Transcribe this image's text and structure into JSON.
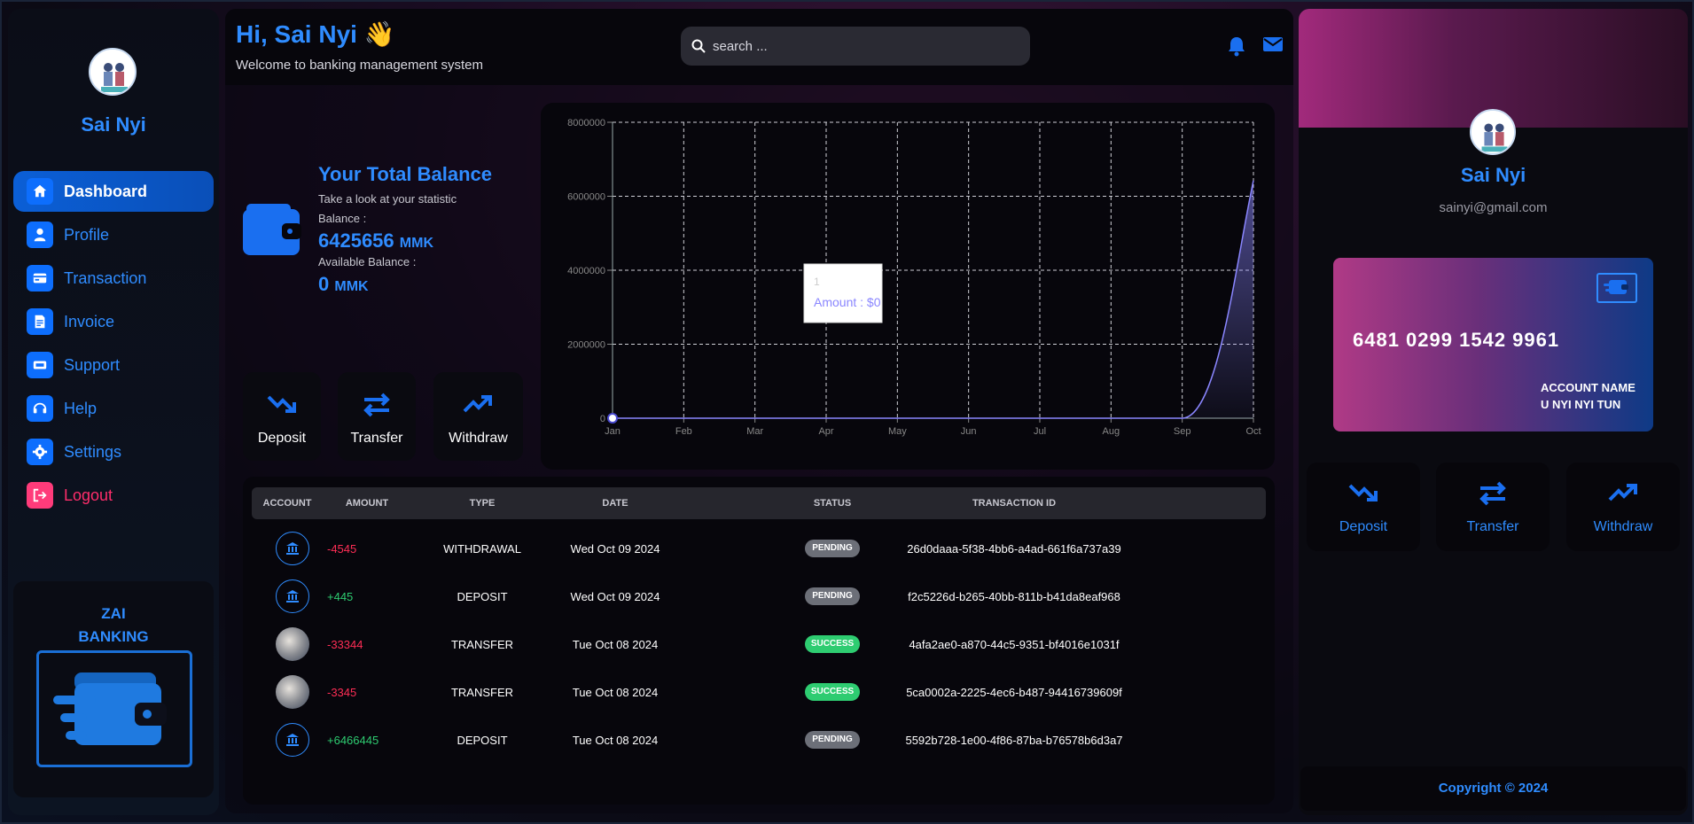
{
  "sidebar": {
    "user_name": "Sai Nyi",
    "items": [
      {
        "label": "Dashboard",
        "icon": "home-icon"
      },
      {
        "label": "Profile",
        "icon": "user-icon"
      },
      {
        "label": "Transaction",
        "icon": "card-icon"
      },
      {
        "label": "Invoice",
        "icon": "invoice-icon"
      },
      {
        "label": "Support",
        "icon": "support-icon"
      },
      {
        "label": "Help",
        "icon": "headset-icon"
      },
      {
        "label": "Settings",
        "icon": "gear-icon"
      },
      {
        "label": "Logout",
        "icon": "logout-icon"
      }
    ],
    "promo_line1": "ZAI",
    "promo_line2": "BANKING"
  },
  "header": {
    "greeting": "Hi, Sai Nyi 👋",
    "subtitle": "Welcome to banking management system",
    "search_placeholder": "search ..."
  },
  "balance": {
    "title": "Your Total Balance",
    "subtitle": "Take a look at your statistic",
    "balance_label": "Balance :",
    "balance_value": "6425656",
    "unit": "MMK",
    "available_label": "Available Balance :",
    "available_value": "0"
  },
  "actions": {
    "deposit": "Deposit",
    "transfer": "Transfer",
    "withdraw": "Withdraw"
  },
  "chart_data": {
    "type": "area",
    "categories": [
      "Jan",
      "Feb",
      "Mar",
      "Apr",
      "May",
      "Jun",
      "Jul",
      "Aug",
      "Sep",
      "Oct"
    ],
    "values": [
      0,
      0,
      0,
      0,
      0,
      0,
      0,
      0,
      0,
      6425656
    ],
    "yticks": [
      "0",
      "2000000",
      "4000000",
      "6000000",
      "8000000"
    ],
    "ylim": [
      0,
      8000000
    ],
    "grid": true,
    "tooltip_title": "1",
    "tooltip_value": "Amount : $0",
    "accent": "#8a86ff"
  },
  "table": {
    "headers": [
      "ACCOUNT",
      "AMOUNT",
      "TYPE",
      "DATE",
      "STATUS",
      "TRANSACTION ID"
    ],
    "rows": [
      {
        "account": "bank",
        "amount": "-4545",
        "type": "WITHDRAWAL",
        "date": "Wed Oct 09 2024",
        "status": "PENDING",
        "id": "26d0daaa-5f38-4bb6-a4ad-661f6a737a39"
      },
      {
        "account": "bank",
        "amount": "+445",
        "type": "DEPOSIT",
        "date": "Wed Oct 09 2024",
        "status": "PENDING",
        "id": "f2c5226d-b265-40bb-811b-b41da8eaf968"
      },
      {
        "account": "photo",
        "amount": "-33344",
        "type": "TRANSFER",
        "date": "Tue Oct 08 2024",
        "status": "SUCCESS",
        "id": "4afa2ae0-a870-44c5-9351-bf4016e1031f"
      },
      {
        "account": "photo",
        "amount": "-3345",
        "type": "TRANSFER",
        "date": "Tue Oct 08 2024",
        "status": "SUCCESS",
        "id": "5ca0002a-2225-4ec6-b487-94416739609f"
      },
      {
        "account": "bank",
        "amount": "+6466445",
        "type": "DEPOSIT",
        "date": "Tue Oct 08 2024",
        "status": "PENDING",
        "id": "5592b728-1e00-4f86-87ba-b76578b6d3a7"
      }
    ]
  },
  "right_panel": {
    "name": "Sai Nyi",
    "email": "sainyi@gmail.com",
    "card_number": "6481 0299 1542 9961",
    "account_name_label": "ACCOUNT NAME",
    "account_name": "U NYI NYI TUN",
    "copyright": "Copyright © 2024"
  },
  "colors": {
    "accent": "#2f8cff",
    "active_nav": "#0b5fd6",
    "logout": "#ff2d6b",
    "negative": "#ff2d55",
    "positive": "#2ecc71"
  }
}
